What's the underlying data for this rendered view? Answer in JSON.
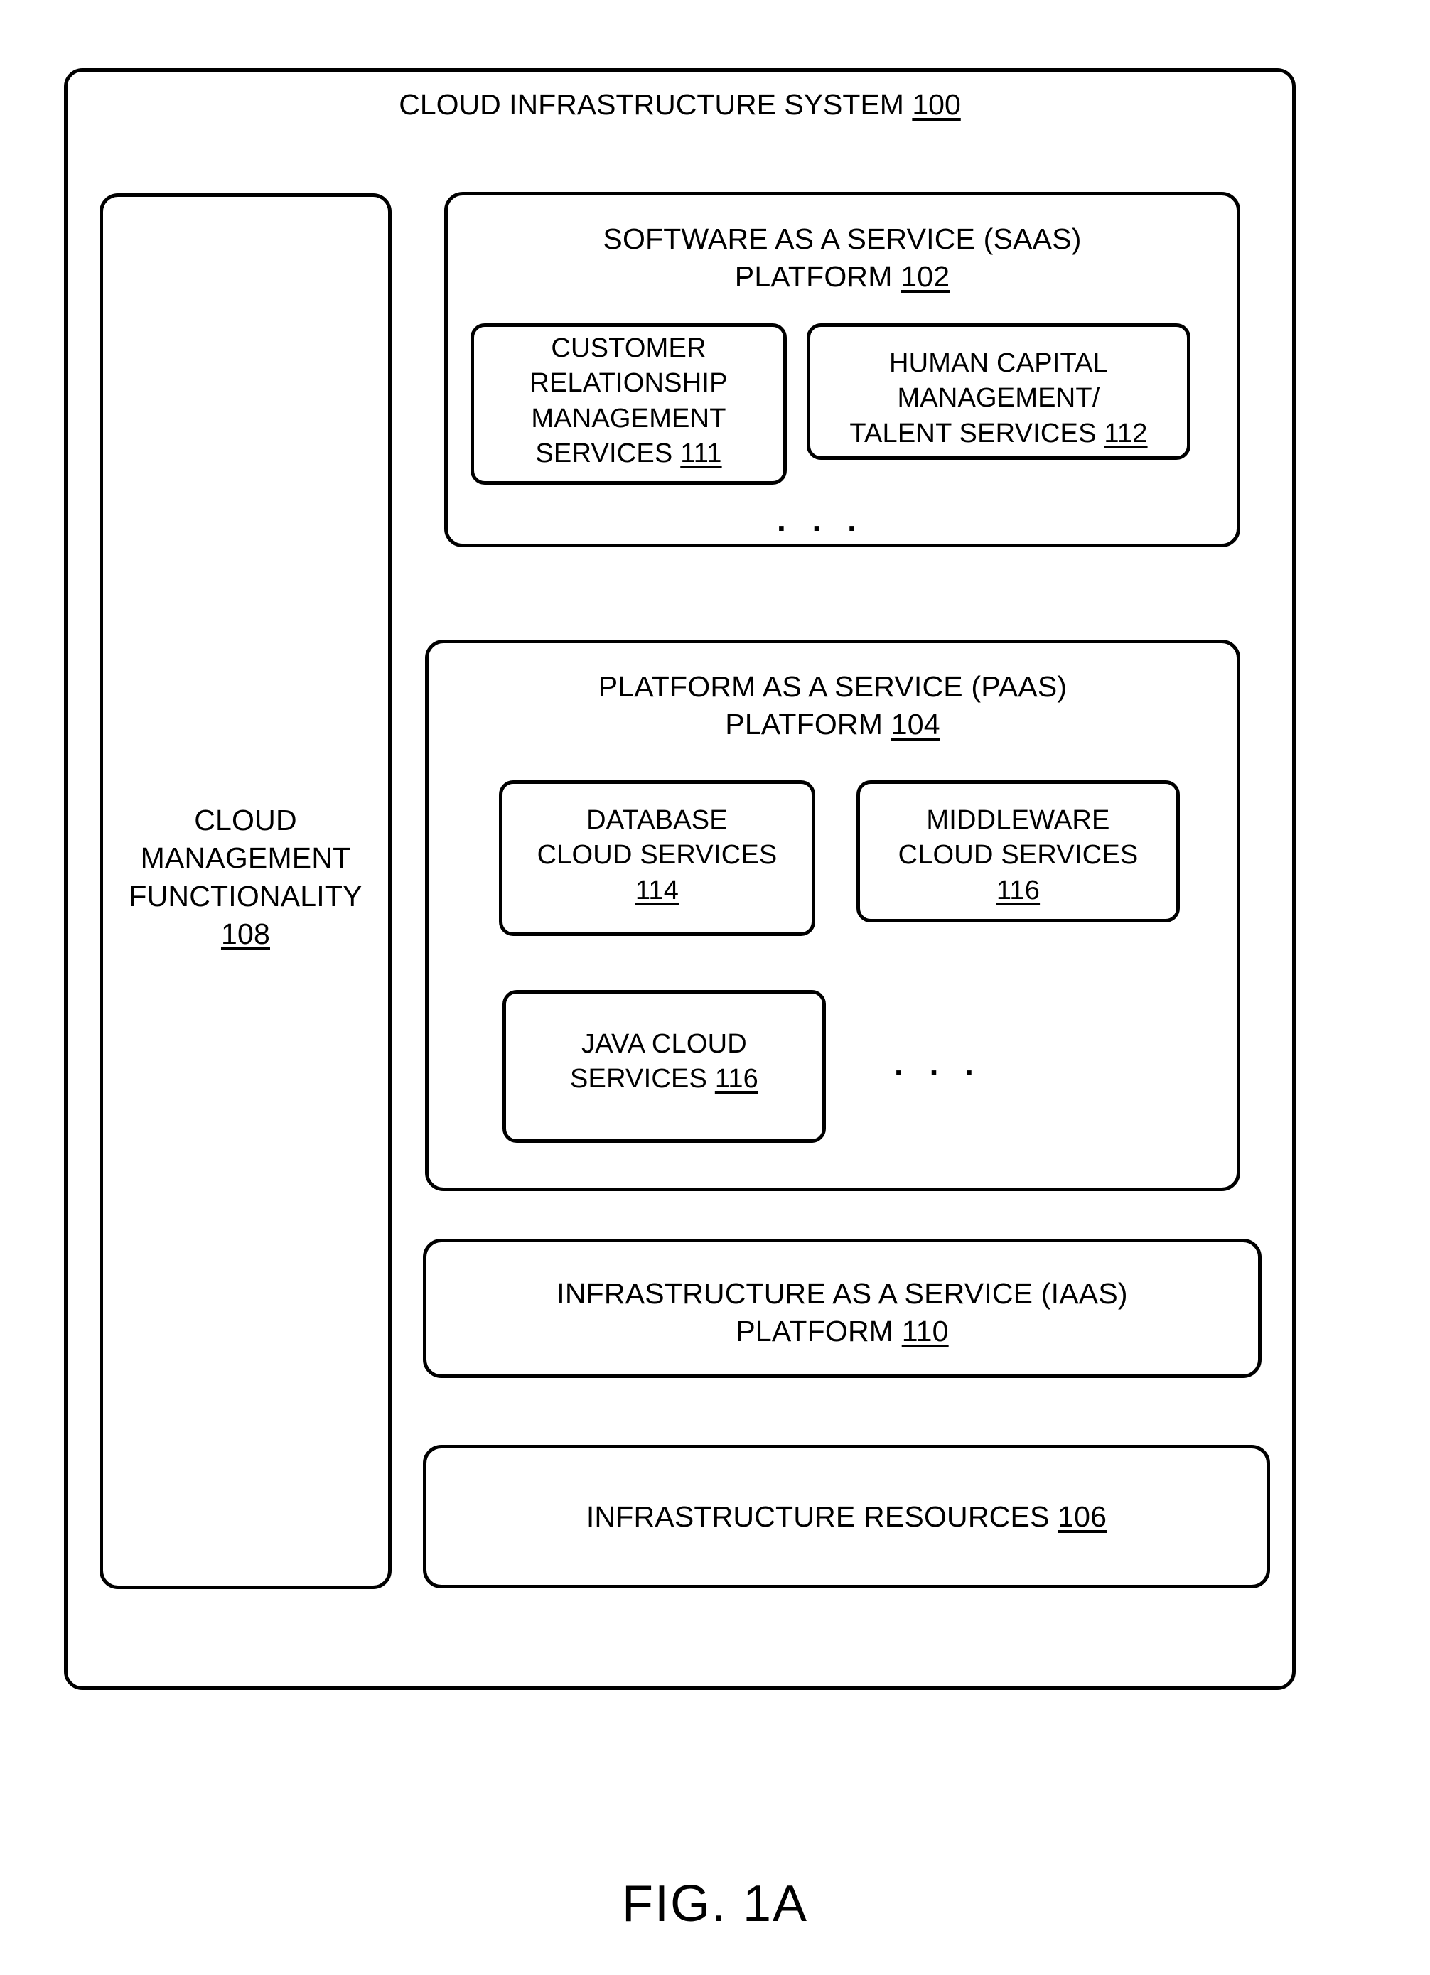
{
  "figure": {
    "caption": "FIG. 1A"
  },
  "system": {
    "title_text": "CLOUD INFRASTRUCTURE SYSTEM ",
    "title_ref": "100"
  },
  "cloud_management": {
    "label": "CLOUD\nMANAGEMENT\nFUNCTIONALITY\n",
    "ref": "108"
  },
  "saas": {
    "title_text": "SOFTWARE AS A SERVICE (SAAS)\nPLATFORM ",
    "title_ref": "102",
    "ellipsis": ". . .",
    "services": [
      {
        "label": "CUSTOMER\nRELATIONSHIP\nMANAGEMENT\nSERVICES ",
        "ref": "111"
      },
      {
        "label": "HUMAN CAPITAL\nMANAGEMENT/\nTALENT SERVICES ",
        "ref": "112"
      }
    ]
  },
  "paas": {
    "title_text": "PLATFORM AS A SERVICE (PAAS)\nPLATFORM ",
    "title_ref": "104",
    "ellipsis": ". . .",
    "services": [
      {
        "label": "DATABASE\nCLOUD SERVICES\n",
        "ref": "114"
      },
      {
        "label": "MIDDLEWARE\nCLOUD SERVICES\n",
        "ref": "116"
      },
      {
        "label": "JAVA CLOUD\nSERVICES ",
        "ref": "116"
      }
    ]
  },
  "iaas": {
    "title_text": "INFRASTRUCTURE AS A SERVICE (IAAS)\nPLATFORM ",
    "title_ref": "110"
  },
  "infrastructure_resources": {
    "title_text": "INFRASTRUCTURE RESOURCES ",
    "title_ref": "106"
  },
  "colors": {
    "stroke": "#000000",
    "background": "#ffffff"
  }
}
